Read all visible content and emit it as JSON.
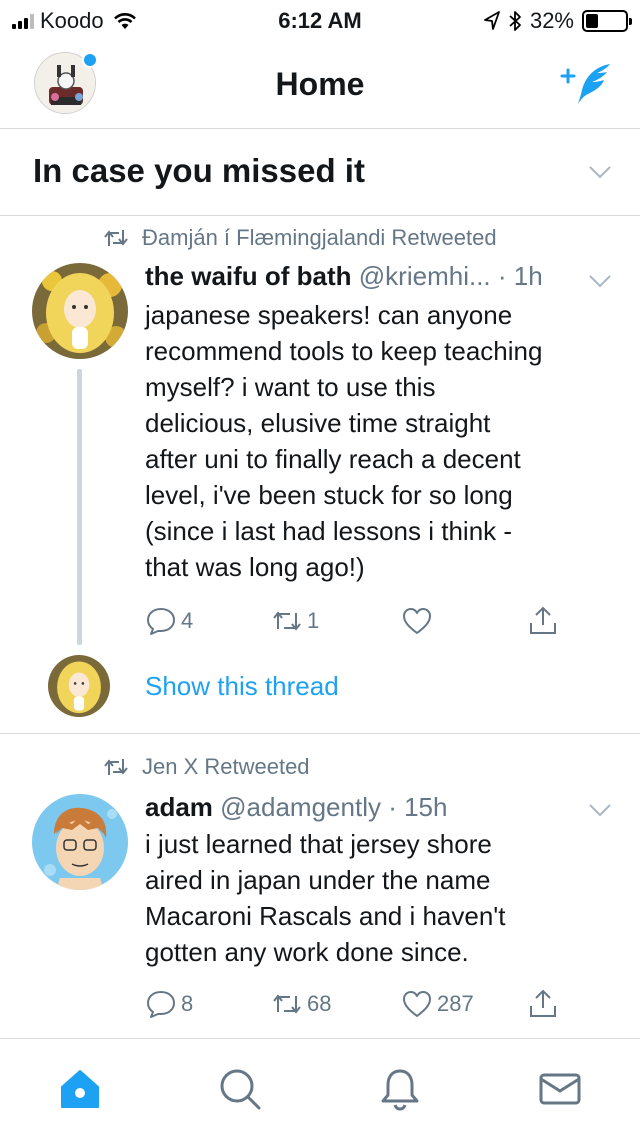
{
  "status_bar": {
    "carrier": "Koodo",
    "time": "6:12 AM",
    "battery": "32%",
    "battery_level": 0.32
  },
  "nav": {
    "title": "Home",
    "accent": "#1da1f2"
  },
  "section": {
    "title": "In case you missed it"
  },
  "tweets": [
    {
      "retweeted_by": "Đamján í Flæmingjalandi Retweeted",
      "name": "the waifu of bath",
      "handle": "@kriemhi...",
      "time": "· 1h",
      "lines": [
        "japanese speakers! can anyone",
        "recommend tools to keep teaching",
        "myself? i want to use this",
        "delicious, elusive time straight",
        "after uni to finally reach a decent",
        "level, i've been stuck for so long",
        "(since i last had lessons i think -",
        "that was long ago!)"
      ],
      "reply_count": "4",
      "retweet_count": "1",
      "like_count": "",
      "show_thread": "Show this thread"
    },
    {
      "retweeted_by": "Jen X Retweeted",
      "name": "adam",
      "handle": "@adamgently",
      "time": "· 15h",
      "lines": [
        "i just learned that jersey shore",
        "aired in japan under the name",
        "Macaroni Rascals and i  haven't",
        "gotten any work done since."
      ],
      "reply_count": "8",
      "retweet_count": "68",
      "like_count": "287"
    }
  ],
  "tab_bar": {
    "items": [
      "home-icon",
      "search-icon",
      "notifications-icon",
      "messages-icon"
    ]
  },
  "icons": {
    "compose": "compose-tweet-icon",
    "chevron": "chevron-down-icon",
    "retweet": "retweet-icon",
    "reply": "reply-icon",
    "like": "like-icon",
    "share": "share-icon"
  }
}
